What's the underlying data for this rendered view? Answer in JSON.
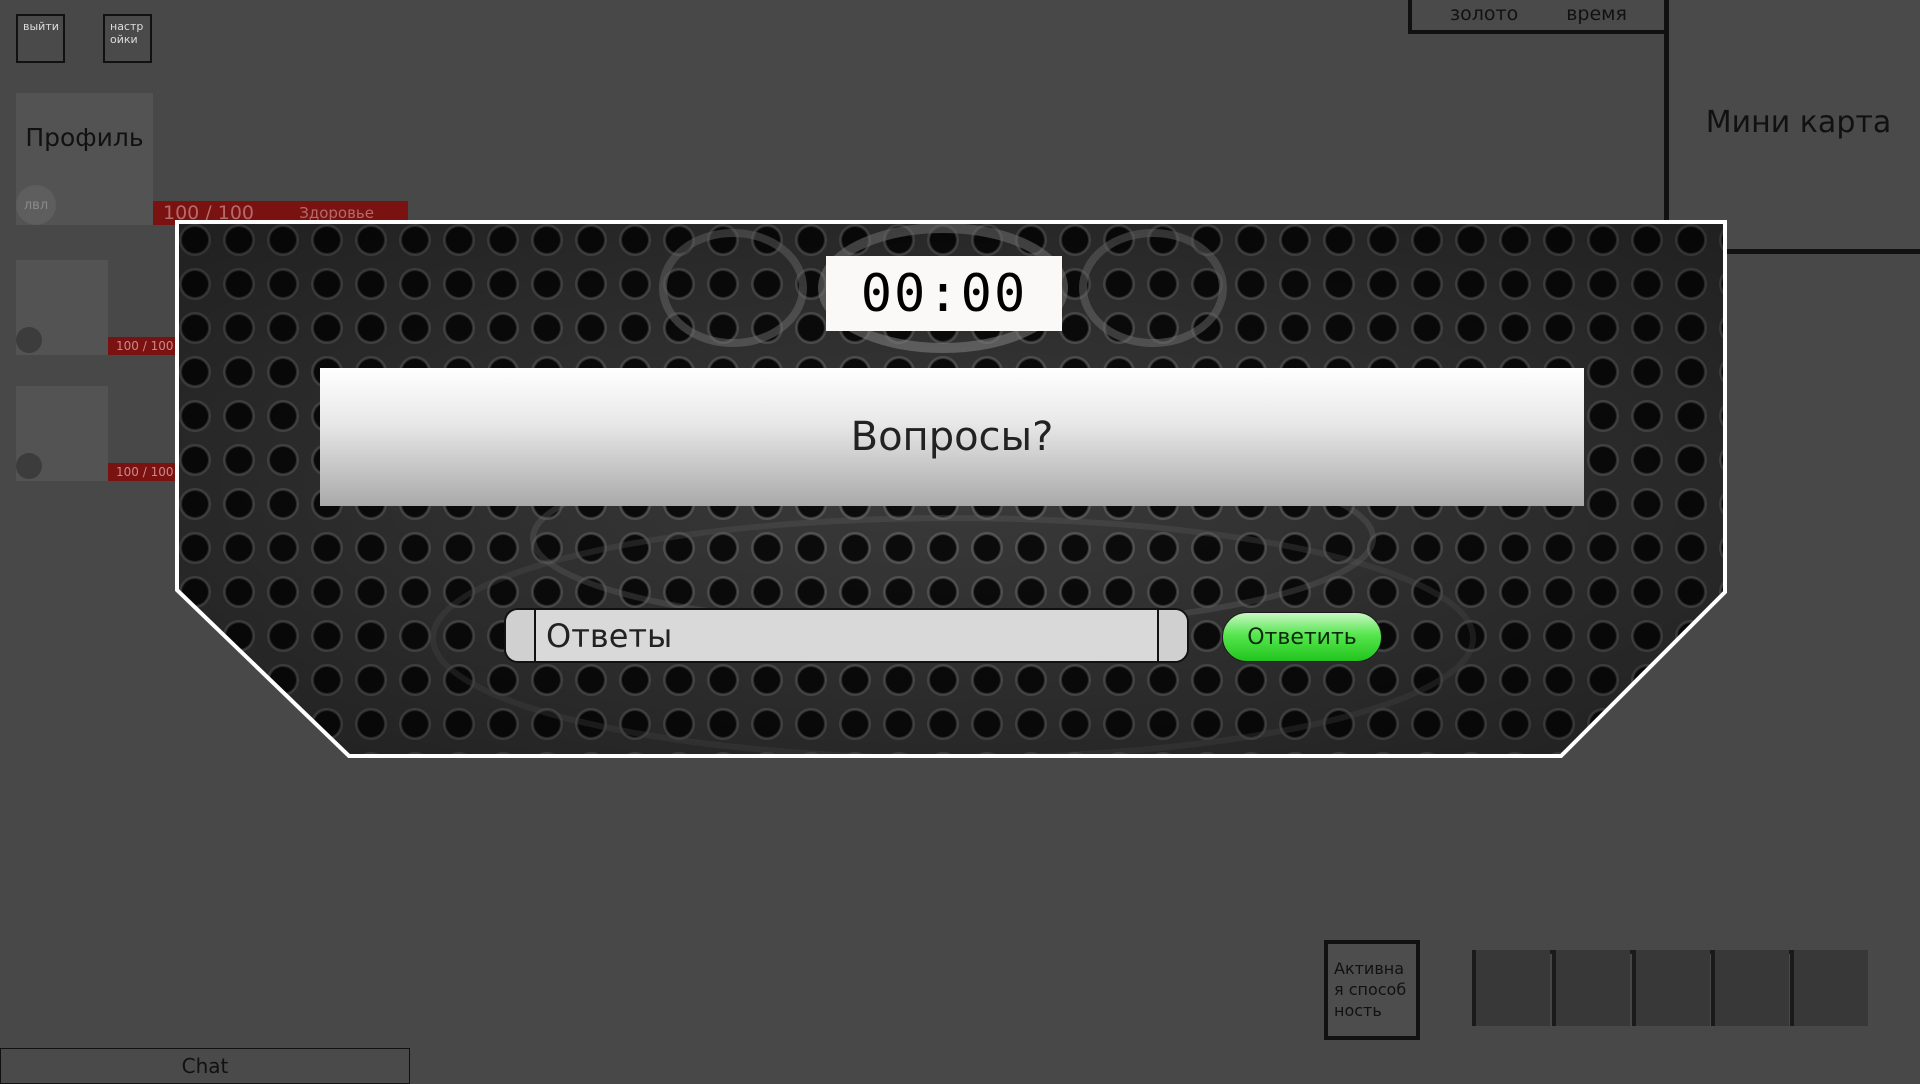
{
  "top_left": {
    "exit_label": "выйти",
    "settings_label": "настр ойки"
  },
  "profile": {
    "title": "Профиль",
    "level_label": "лвл",
    "health_value": "100 / 100",
    "health_label": "Здоровье"
  },
  "party": [
    {
      "hp": "100 / 100"
    },
    {
      "hp": "100 / 100"
    }
  ],
  "resources": {
    "gold_label": "золото",
    "time_label": "время"
  },
  "minimap": {
    "label": "Мини карта"
  },
  "quiz": {
    "timer": "00:00",
    "question": "Вопросы?",
    "answer_placeholder": "Ответы",
    "submit_label": "Ответить"
  },
  "chat": {
    "label": "Chat"
  },
  "ability": {
    "label": "Активная способность"
  },
  "hotbar": {
    "slot_count": 5
  },
  "colors": {
    "background": "#484848",
    "health": "#7a1212",
    "submit": "#3dd636"
  }
}
